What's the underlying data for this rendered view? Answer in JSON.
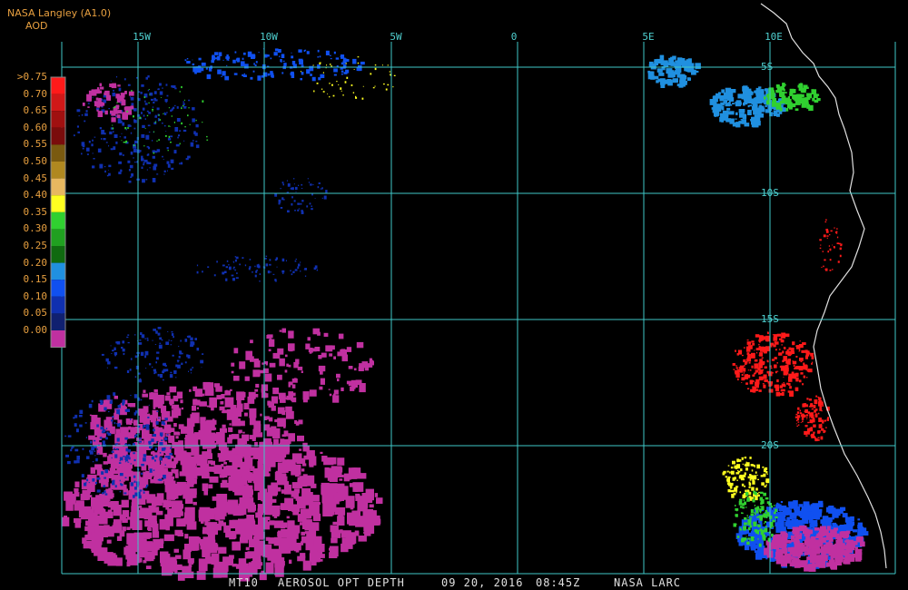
{
  "header": {
    "source": "NASA Langley (A1.0)",
    "product_code": "AOD"
  },
  "grid": {
    "longitude_labels": [
      "15W",
      "10W",
      "5W",
      "0",
      "5E",
      "10E"
    ],
    "latitude_labels": [
      "5S",
      "10S",
      "15S",
      "20S"
    ],
    "line_color": "#3fc8c8"
  },
  "legend": {
    "labels": [
      ">0.75",
      "0.70",
      "0.65",
      "0.60",
      "0.55",
      "0.50",
      "0.45",
      "0.40",
      "0.35",
      "0.30",
      "0.25",
      "0.20",
      "0.15",
      "0.10",
      "0.05",
      "0.00"
    ],
    "colors": [
      "#ff1a1a",
      "#d01818",
      "#a01010",
      "#7a0c0c",
      "#7a5a10",
      "#b08820",
      "#e8b860",
      "#ffff20",
      "#30d030",
      "#20a020",
      "#106a10",
      "#2090e0",
      "#1050f0",
      "#1030b0",
      "#102070",
      "#c030a0"
    ]
  },
  "map": {
    "coastline_color": "#e0e0e0",
    "aerosol_colors": {
      "clean": "#c030a0",
      "low": "#1030b0",
      "low_mid": "#1050f0",
      "moderate": "#2090e0",
      "green": "#30d030",
      "yellow": "#ffff20",
      "high": "#ff1a1a"
    }
  },
  "footer": {
    "satellite": "MT10",
    "product": "AEROSOL OPT DEPTH",
    "date": "09 20, 2016",
    "time": "08:45Z",
    "agency": "NASA LARC"
  }
}
